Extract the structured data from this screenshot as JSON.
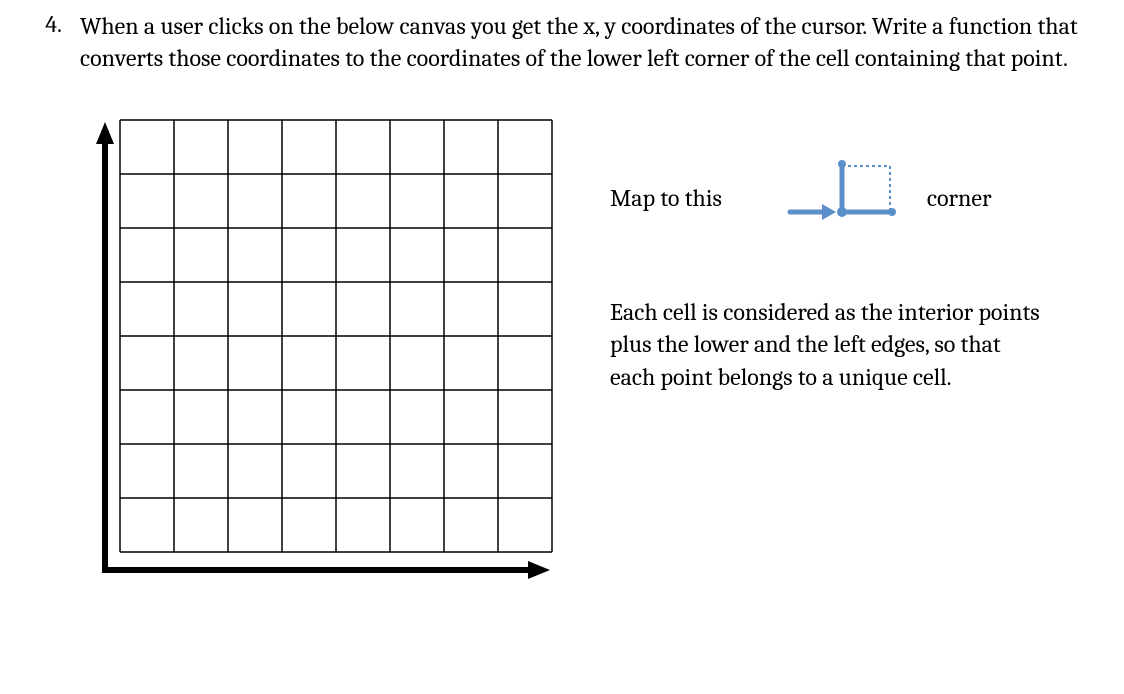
{
  "question": {
    "number": "4.",
    "text": "When a user clicks on the below canvas you get the x, y coordinates of the cursor. Write a function that converts those coordinates to the coordinates of the lower left corner of the cell containing that point."
  },
  "mapLabel": "Map to this",
  "cornerLabel": "corner",
  "description": "Each cell is considered as the interior points plus the lower and the left edges, so that each point belongs to a unique cell.",
  "grid": {
    "rows": 8,
    "cols": 8
  }
}
